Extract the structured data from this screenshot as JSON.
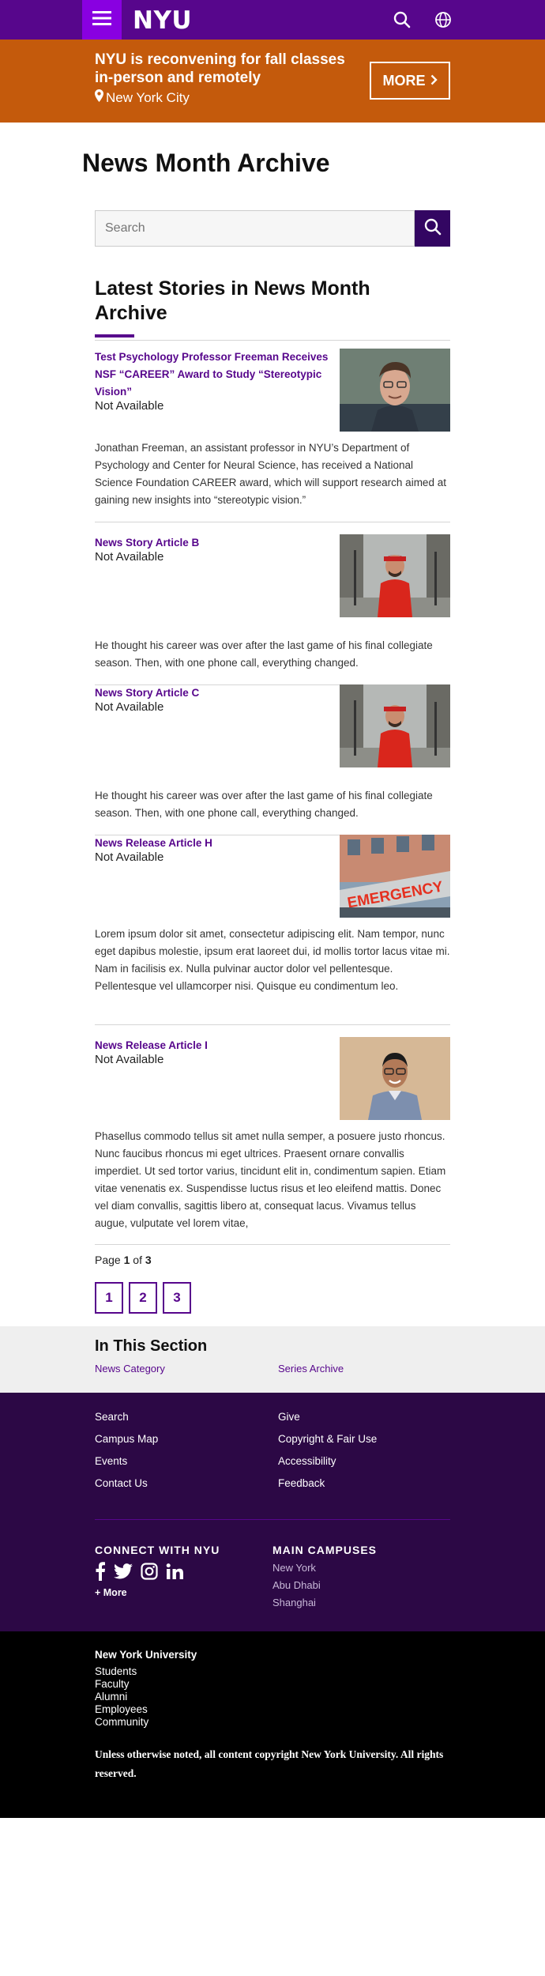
{
  "header": {
    "logo": "NYU",
    "menu_icon": "hamburger-icon",
    "search_icon": "search-icon",
    "globe_icon": "globe-icon",
    "bg_color": "#57068c",
    "menu_color": "#8900e1"
  },
  "alert": {
    "title": "NYU is reconvening for fall classes in-person and remotely",
    "location": "New York City",
    "more_label": "MORE",
    "bg_color": "#c45a0c"
  },
  "page": {
    "title": "News Month Archive",
    "search_placeholder": "Search",
    "section_title": "Latest Stories in News Month Archive"
  },
  "stories": [
    {
      "title": "Test Psychology Professor Freeman Receives NSF “CAREER” Award to Study “Stereotypic Vision”",
      "meta": "Not Available",
      "body": "Jonathan Freeman, an assistant professor in NYU’s Department of Psychology and Center for Neural Science, has received a National Science Foundation CAREER award, which will support research aimed at gaining new insights into “stereotypic vision.”"
    },
    {
      "title": "News Story Article B",
      "meta": "Not Available",
      "body": "He thought his career was over after the last game of his final collegiate season. Then, with one phone call, everything changed."
    },
    {
      "title": "News Story Article C",
      "meta": "Not Available",
      "body": "He thought his career was over after the last game of his final collegiate season. Then, with one phone call, everything changed."
    },
    {
      "title": "News Release Article H",
      "meta": "Not Available",
      "body": "Lorem ipsum dolor sit amet, consectetur adipiscing elit. Nam tempor, nunc eget dapibus molestie, ipsum erat laoreet dui, id mollis tortor lacus vitae mi. Nam in facilisis ex. Nulla pulvinar auctor dolor vel pellentesque. Pellentesque vel ullamcorper nisi. Quisque eu condimentum leo.",
      "image_text": "EMERGENCY"
    },
    {
      "title": "News Release Article I",
      "meta": "Not Available",
      "body": "Phasellus commodo tellus sit amet nulla semper, a posuere justo rhoncus. Nunc faucibus rhoncus mi eget ultrices. Praesent ornare convallis imperdiet. Ut sed tortor varius, tincidunt elit in, condimentum sapien. Etiam vitae venenatis ex. Suspendisse luctus risus et leo eleifend mattis. Donec vel diam convallis, sagittis libero at, consequat lacus. Vivamus tellus augue, vulputate vel lorem vitae,"
    }
  ],
  "pagination": {
    "label_prefix": "Page",
    "current": "1",
    "label_of": "of",
    "total": "3",
    "pages": [
      "1",
      "2",
      "3"
    ]
  },
  "in_section": {
    "title": "In This Section",
    "links": [
      "News Category",
      "Series Archive"
    ]
  },
  "footer": {
    "links_left": [
      "Search",
      "Campus Map",
      "Events",
      "Contact Us"
    ],
    "links_right": [
      "Give",
      "Copyright & Fair Use",
      "Accessibility",
      "Feedback"
    ],
    "connect_title": "CONNECT WITH NYU",
    "social_icons": [
      "facebook-icon",
      "twitter-icon",
      "instagram-icon",
      "linkedin-icon"
    ],
    "more_label": "+ More",
    "campuses_title": "MAIN CAMPUSES",
    "campuses": [
      "New York",
      "Abu Dhabi",
      "Shanghai"
    ]
  },
  "bottom": {
    "title": "New York University",
    "links": [
      "Students",
      "Faculty",
      "Alumni",
      "Employees",
      "Community"
    ],
    "copyright": "Unless otherwise noted, all content copyright New York University. All rights reserved."
  }
}
